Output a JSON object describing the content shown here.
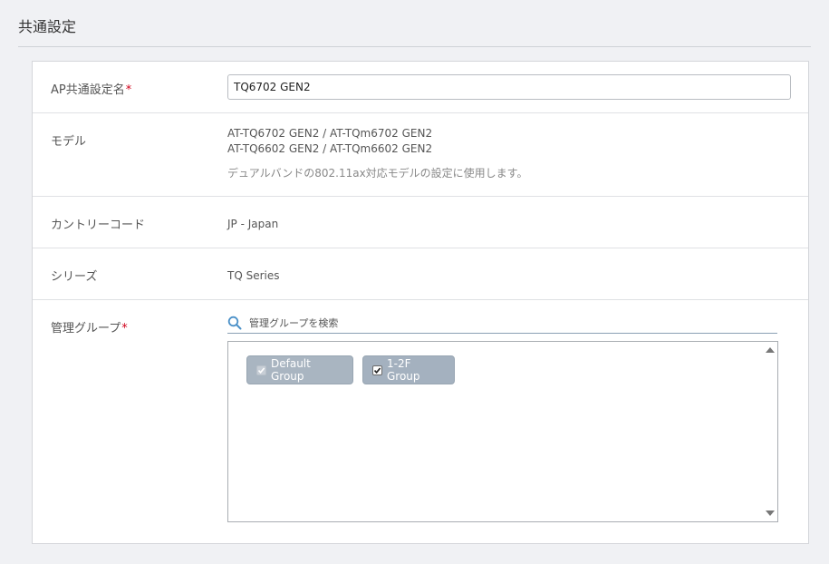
{
  "section": {
    "title": "共通設定"
  },
  "form": {
    "name": {
      "label": "AP共通設定名",
      "required_mark": "*",
      "value": "TQ6702 GEN2"
    },
    "model": {
      "label": "モデル",
      "lines": [
        "AT-TQ6702 GEN2 / AT-TQm6702 GEN2",
        "AT-TQ6602 GEN2 / AT-TQm6602 GEN2"
      ],
      "description": "デュアルバンドの802.11ax対応モデルの設定に使用します。"
    },
    "country": {
      "label": "カントリーコード",
      "value": "JP - Japan"
    },
    "series": {
      "label": "シリーズ",
      "value": "TQ Series"
    },
    "groups": {
      "label": "管理グループ",
      "required_mark": "*",
      "search_placeholder": "管理グループを検索",
      "items": [
        {
          "label": "Default Group",
          "checked": true,
          "disabled": true
        },
        {
          "label": "1-2F Group",
          "checked": true,
          "disabled": false
        }
      ]
    }
  },
  "colors": {
    "chip_bg": "#a9b5c1",
    "required": "#d0021b",
    "search_icon": "#4a90c8"
  }
}
